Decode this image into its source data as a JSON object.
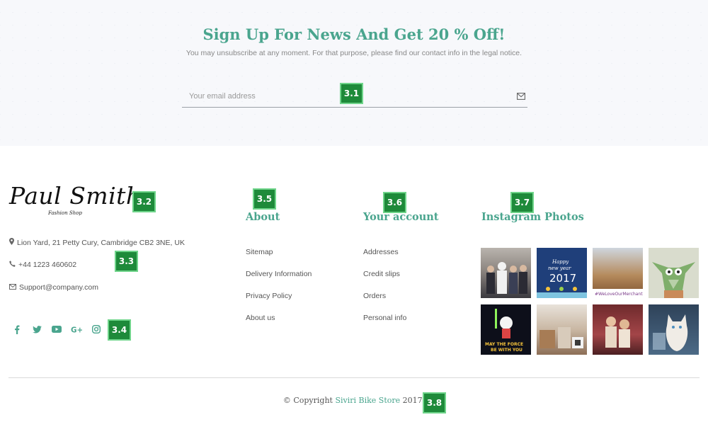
{
  "newsletter": {
    "title": "Sign Up For News And Get 20 % Off!",
    "subtitle": "You may unsubscribe at any moment. For that purpose, please find our contact info in the legal notice.",
    "email_placeholder": "Your email address",
    "submit_icon": "envelope-icon"
  },
  "badges": {
    "b31": "3.1",
    "b32": "3.2",
    "b33": "3.3",
    "b34": "3.4",
    "b35": "3.5",
    "b36": "3.6",
    "b37": "3.7",
    "b38": "3.8"
  },
  "brand": {
    "logo_text": "Paul Smith",
    "logo_tagline": "Fashion Shop"
  },
  "contact": {
    "address": "Lion Yard, 21 Petty Cury, Cambridge CB2 3NE, UK",
    "phone": "+44 1223 460602",
    "email": "Support@company.com",
    "icons": [
      "map-marker-icon",
      "phone-icon",
      "envelope-icon"
    ]
  },
  "social_icons": [
    "facebook-icon",
    "twitter-icon",
    "youtube-icon",
    "google-plus-icon",
    "instagram-icon"
  ],
  "about": {
    "title": "About",
    "links": [
      "Sitemap",
      "Delivery Information",
      "Privacy Policy",
      "About us"
    ]
  },
  "account": {
    "title": "Your account",
    "links": [
      "Addresses",
      "Credit slips",
      "Orders",
      "Personal info"
    ]
  },
  "instagram": {
    "title": "Instagram Photos",
    "photos": [
      "team-photo",
      "happy-new-year-2017",
      "we-love-our-merchants",
      "yoda-illustration",
      "may-the-force-be-with-you",
      "office-photo",
      "friends-photo",
      "cat-photo"
    ]
  },
  "footer": {
    "copyright_prefix": "© Copyright",
    "store_name": "Siviri Bike Store",
    "copyright_suffix": "2017."
  },
  "colors": {
    "accent": "#4aa58e",
    "badge_bg": "#1e8a3a"
  }
}
